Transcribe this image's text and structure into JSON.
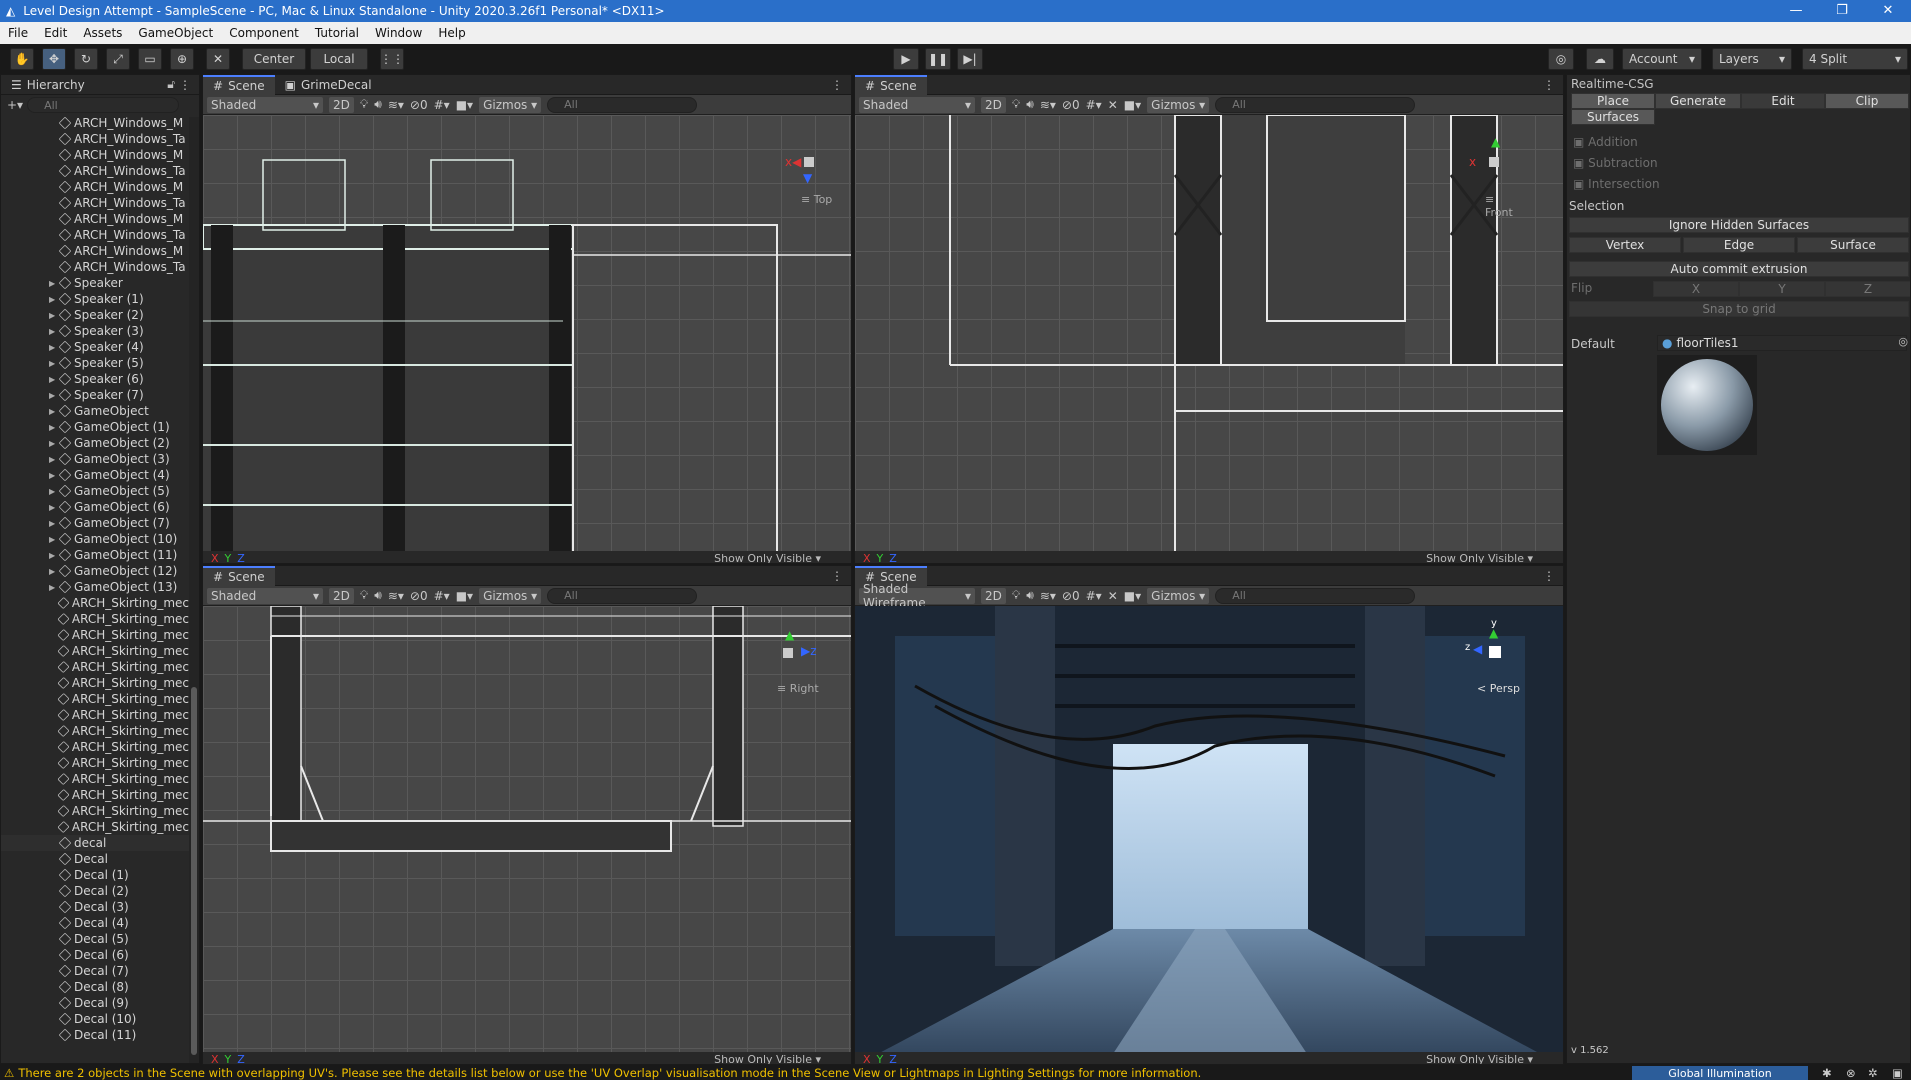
{
  "window": {
    "title": "Level Design Attempt - SampleScene - PC, Mac & Linux Standalone - Unity 2020.3.26f1 Personal* <DX11>"
  },
  "menu": [
    "File",
    "Edit",
    "Assets",
    "GameObject",
    "Component",
    "Tutorial",
    "Window",
    "Help"
  ],
  "toolbar": {
    "pivot": "Center",
    "space": "Local",
    "account": "Account",
    "layers": "Layers",
    "layout": "4 Split"
  },
  "hierarchy": {
    "title": "Hierarchy",
    "search_placeholder": "All",
    "items": [
      "ARCH_Windows_M",
      "ARCH_Windows_Ta",
      "ARCH_Windows_M",
      "ARCH_Windows_Ta",
      "ARCH_Windows_M",
      "ARCH_Windows_Ta",
      "ARCH_Windows_M",
      "ARCH_Windows_Ta",
      "ARCH_Windows_M",
      "ARCH_Windows_Ta",
      "Speaker",
      "Speaker (1)",
      "Speaker (2)",
      "Speaker (3)",
      "Speaker (4)",
      "Speaker (5)",
      "Speaker (6)",
      "Speaker (7)",
      "GameObject",
      "GameObject (1)",
      "GameObject (2)",
      "GameObject (3)",
      "GameObject (4)",
      "GameObject (5)",
      "GameObject (6)",
      "GameObject (7)",
      "GameObject (10)",
      "GameObject (11)",
      "GameObject (12)",
      "GameObject (13)",
      "ARCH_Skirting_mec",
      "ARCH_Skirting_mec",
      "ARCH_Skirting_mec",
      "ARCH_Skirting_mec",
      "ARCH_Skirting_mec",
      "ARCH_Skirting_mec",
      "ARCH_Skirting_mec",
      "ARCH_Skirting_mec",
      "ARCH_Skirting_mec",
      "ARCH_Skirting_mec",
      "ARCH_Skirting_mec",
      "ARCH_Skirting_mec",
      "ARCH_Skirting_mec",
      "ARCH_Skirting_mec",
      "ARCH_Skirting_mec",
      "decal",
      "Decal",
      "Decal (1)",
      "Decal (2)",
      "Decal (3)",
      "Decal (4)",
      "Decal (5)",
      "Decal (6)",
      "Decal (7)",
      "Decal (8)",
      "Decal (9)",
      "Decal (10)",
      "Decal (11)"
    ]
  },
  "scenes": {
    "top": {
      "tab1": "Scene",
      "tab2": "GrimeDecal",
      "mode": "Shaded",
      "two_d": "2D",
      "hidden": "0",
      "gizmos": "Gizmos",
      "search": "All",
      "axis": "Top",
      "show_only": "Show Only Visible"
    },
    "front": {
      "tab1": "Scene",
      "mode": "Shaded",
      "two_d": "2D",
      "hidden": "0",
      "gizmos": "Gizmos",
      "search": "All",
      "axis": "Front",
      "show_only": "Show Only Visible"
    },
    "right": {
      "tab1": "Scene",
      "mode": "Shaded",
      "two_d": "2D",
      "hidden": "0",
      "gizmos": "Gizmos",
      "search": "All",
      "axis": "Right",
      "show_only": "Show Only Visible"
    },
    "persp": {
      "tab1": "Scene",
      "mode": "Shaded Wireframe",
      "two_d": "2D",
      "hidden": "0",
      "gizmos": "Gizmos",
      "search": "All",
      "axis": "Persp",
      "show_only": "Show Only Visible"
    }
  },
  "csg": {
    "title": "Realtime-CSG",
    "tabs": [
      "Place",
      "Generate",
      "Edit",
      "Clip",
      "Surfaces"
    ],
    "ops": [
      "Addition",
      "Subtraction",
      "Intersection"
    ],
    "selection_label": "Selection",
    "ignore_hidden": "Ignore Hidden Surfaces",
    "modes": [
      "Vertex",
      "Edge",
      "Surface"
    ],
    "auto_commit": "Auto commit extrusion",
    "flip_label": "Flip",
    "flip_axes": [
      "X",
      "Y",
      "Z"
    ],
    "snap": "Snap to grid",
    "default_label": "Default",
    "material": "floorTiles1",
    "version": "v 1.562"
  },
  "status": {
    "message": "There are 2 objects in the Scene with overlapping UV's. Please see the details list below or use the 'UV Overlap' visualisation mode in the Scene View or Lightmaps in Lighting Settings for more information.",
    "gi": "Global Illumination"
  }
}
